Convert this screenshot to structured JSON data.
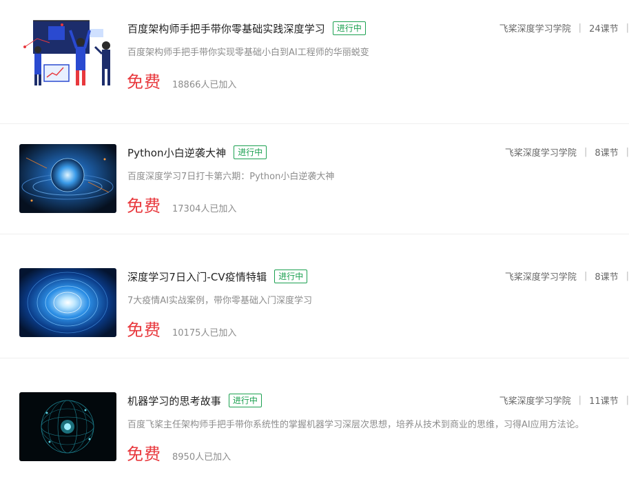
{
  "courses": [
    {
      "title": "百度架构师手把手带你零基础实践深度学习",
      "status": "进行中",
      "desc": "百度架构师手把手带你实现零基础小白到AI工程师的华丽蜕变",
      "price": "免费",
      "joined": "18866人已加入",
      "academy": "飞桨深度学习学院",
      "lessons": "24课节",
      "thumb_icon": "illustration-people-icon"
    },
    {
      "title": "Python小白逆袭大神",
      "status": "进行中",
      "desc": "百度深度学习7日打卡第六期：Python小白逆袭大神",
      "price": "免费",
      "joined": "17304人已加入",
      "academy": "飞桨深度学习学院",
      "lessons": "8课节",
      "thumb_icon": "tech-sphere-icon"
    },
    {
      "title": "深度学习7日入门-CV疫情特辑",
      "status": "进行中",
      "desc": "7大疫情AI实战案例，带你零基础入门深度学习",
      "price": "免费",
      "joined": "10175人已加入",
      "academy": "飞桨深度学习学院",
      "lessons": "8课节",
      "thumb_icon": "blue-tunnel-icon"
    },
    {
      "title": "机器学习的思考故事",
      "status": "进行中",
      "desc": "百度飞桨主任架构师手把手带你系统性的掌握机器学习深层次思想，培养从技术到商业的思维，习得AI应用方法论。",
      "price": "免费",
      "joined": "8950人已加入",
      "academy": "飞桨深度学习学院",
      "lessons": "11课节",
      "thumb_icon": "network-globe-icon"
    }
  ],
  "colors": {
    "price": "#e8383d",
    "badge": "#1aa04f",
    "muted": "#8c8c8c"
  }
}
